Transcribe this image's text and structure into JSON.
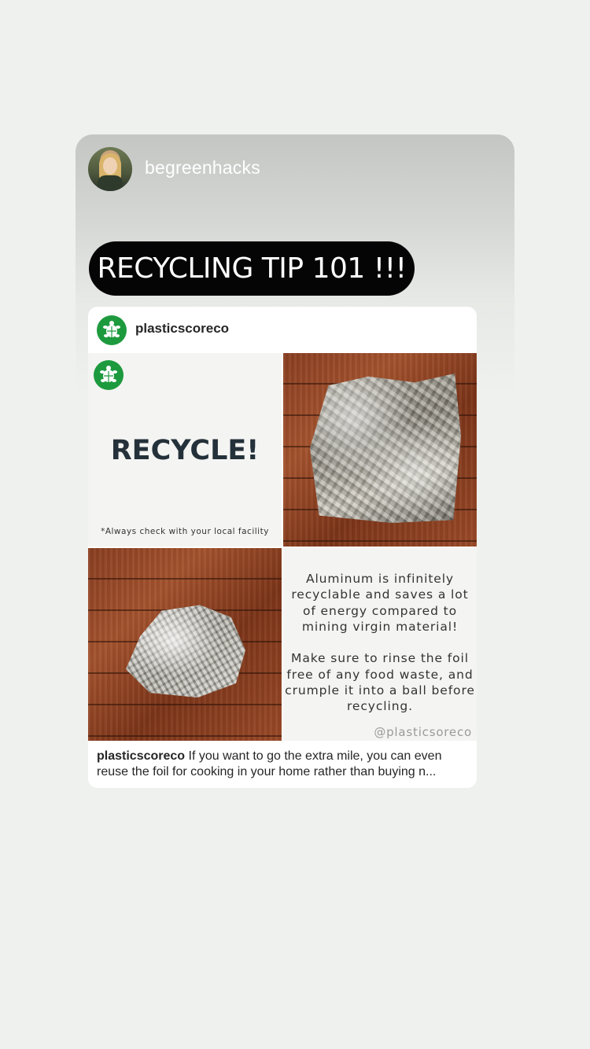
{
  "story": {
    "username": "begreenhacks",
    "banner_text": "RECYCLING TIP 101 !!!"
  },
  "post": {
    "author": "plasticscoreco",
    "panels": {
      "title": "RECYCLE!",
      "disclaimer": "*Always check with your local facility",
      "info_text": "Aluminum is infinitely\nrecyclable and saves a lot\nof energy compared to\nmining virgin material!\n\nMake sure to rinse the foil\nfree of any food waste, and\ncrumple it into a ball before\nrecycling.",
      "watermark": "@plasticsoreco"
    },
    "caption": {
      "user": "plasticscoreco",
      "text": " If you want to go the extra mile, you can even reuse the foil for cooking in your home rather than buying n..."
    }
  },
  "colors": {
    "brand_green": "#1e9a3e",
    "banner_bg": "#050505",
    "title_color": "#24313a"
  },
  "icons": {
    "avatar": "user-avatar-photo",
    "brand": "turtle-logo-icon"
  }
}
